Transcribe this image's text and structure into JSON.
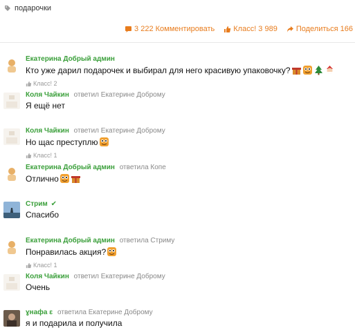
{
  "topic": {
    "tag": "подарочки"
  },
  "actions": {
    "comment_label": "3 222 Комментировать",
    "like_label": "Класс! 3 989",
    "share_label": "Поделиться 166",
    "accent": "#e87c1d"
  },
  "colors": {
    "author": "#3a9f3a",
    "reply": "#888888",
    "likes": "#999999"
  },
  "comments": [
    {
      "author": "Екатерина Добрый админ",
      "reply": "",
      "text": "Кто уже дарил подарочек и выбирал для него красивую упаковочку?",
      "emojis": [
        "gift-icon",
        "smiley-face-icon",
        "christmas-tree-icon",
        "santa-icon"
      ],
      "likes": "Класс! 2"
    },
    {
      "author": "Коля Чайкин",
      "reply": "ответил Екатерине Доброму",
      "text": "Я ещё нет",
      "emojis": [],
      "likes": ""
    },
    {
      "author": "Коля Чайкин",
      "reply": "ответил Екатерине Доброму",
      "text": "Но щас преступлю",
      "emojis": [
        "smiley-face-icon"
      ],
      "likes": "Класс! 1"
    },
    {
      "author": "Екатерина Добрый админ",
      "reply": "ответила Копе",
      "text": "Отлично",
      "emojis": [
        "smiley-face-icon",
        "gift-icon"
      ],
      "likes": ""
    },
    {
      "author": "Стрим",
      "reply": "",
      "verified": "✔",
      "text": "Спасибо",
      "emojis": [],
      "likes": ""
    },
    {
      "author": "Екатерина Добрый админ",
      "reply": "ответила Стриму",
      "text": "Понравилась акция?",
      "emojis": [
        "smiley-face-icon"
      ],
      "likes": "Класс! 1"
    },
    {
      "author": "Коля Чайкин",
      "reply": "ответил Екатерине Доброму",
      "text": "Очень",
      "emojis": [],
      "likes": ""
    },
    {
      "author": "ɣнафа ɛ",
      "reply": "ответила Екатерине Доброму",
      "text": "я и подарила и получила",
      "emojis": [],
      "likes": ""
    }
  ]
}
